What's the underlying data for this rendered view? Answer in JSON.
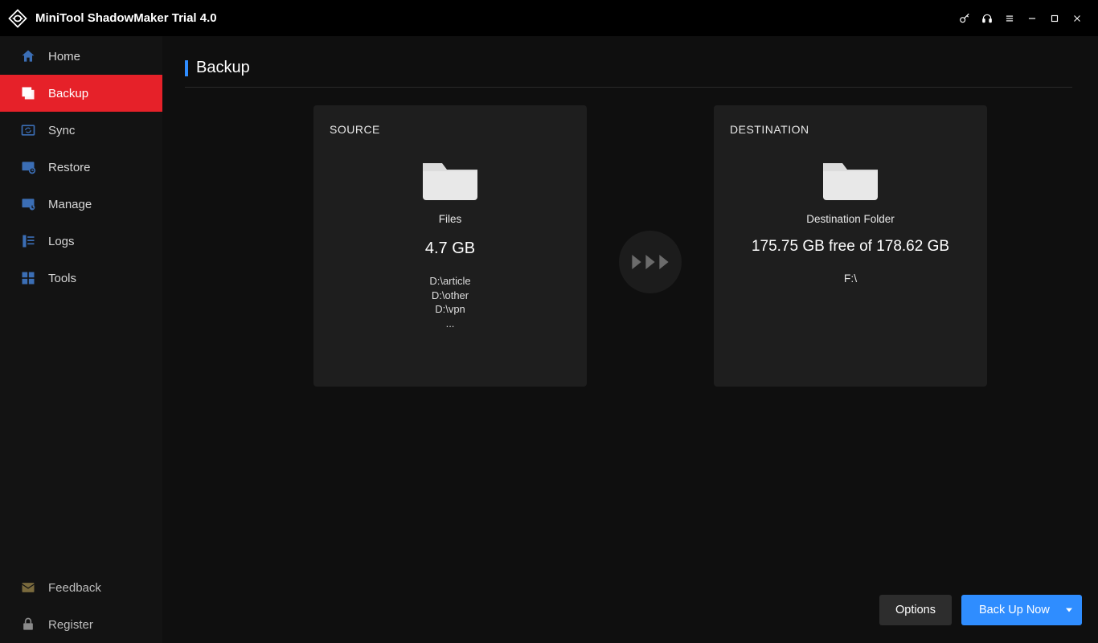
{
  "titlebar": {
    "title": "MiniTool ShadowMaker Trial 4.0"
  },
  "sidebar": {
    "items": [
      {
        "label": "Home"
      },
      {
        "label": "Backup"
      },
      {
        "label": "Sync"
      },
      {
        "label": "Restore"
      },
      {
        "label": "Manage"
      },
      {
        "label": "Logs"
      },
      {
        "label": "Tools"
      }
    ],
    "active_index": 1,
    "footer": [
      {
        "label": "Feedback"
      },
      {
        "label": "Register"
      }
    ]
  },
  "page": {
    "title": "Backup"
  },
  "source": {
    "heading": "SOURCE",
    "type_label": "Files",
    "size": "4.7 GB",
    "paths": [
      "D:\\article",
      "D:\\other",
      "D:\\vpn",
      "..."
    ]
  },
  "destination": {
    "heading": "DESTINATION",
    "type_label": "Destination Folder",
    "space": "175.75 GB free of 178.62 GB",
    "path": "F:\\"
  },
  "actions": {
    "options": "Options",
    "backup": "Back Up Now"
  }
}
